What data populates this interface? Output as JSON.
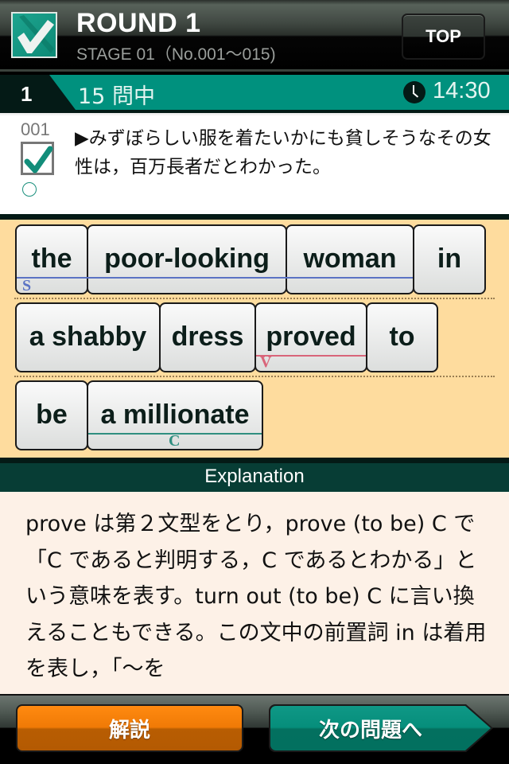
{
  "header": {
    "title": "ROUND 1",
    "subtitle": "STAGE 01（No.001～015)",
    "top_button": "TOP",
    "logo_icon": "checkmark-pencil-icon"
  },
  "question_bar": {
    "number": "1",
    "count_label": "15 問中",
    "timer_icon": "clock-icon",
    "timer": "14:30"
  },
  "question": {
    "id": "001",
    "checked": true,
    "status_icon": "circle-icon",
    "text": "▶みずぼらしい服を着たいかにも貧しそうなその女性は，百万長者だとわかった。"
  },
  "tiles": {
    "rows": [
      [
        {
          "word": "the"
        },
        {
          "word": "poor-looking"
        },
        {
          "word": "woman"
        },
        {
          "word": "in"
        }
      ],
      [
        {
          "word": "a shabby"
        },
        {
          "word": "dress"
        },
        {
          "word": "proved"
        },
        {
          "word": "to"
        }
      ],
      [
        {
          "word": "be"
        },
        {
          "word": "a millionate"
        }
      ]
    ],
    "roles": {
      "subject": {
        "label": "S",
        "color": "#5b73c4"
      },
      "verb": {
        "label": "V",
        "color": "#d9657a"
      },
      "complement": {
        "label": "C",
        "color": "#2f8f80"
      }
    }
  },
  "explanation": {
    "title": "Explanation",
    "text": "prove は第２文型をとり，prove (to be) C で「C であると判明する，C であるとわかる」という意味を表す。turn out (to be) C に言い換えることもできる。この文中の前置詞 in は着用を表し，「～を"
  },
  "footer": {
    "explain_button": "解説",
    "next_button": "次の問題へ"
  },
  "colors": {
    "accent_teal": "#00917e",
    "dark_green": "#041a16",
    "tile_area": "#fedc9e",
    "explanation_bg": "#fdf1e7",
    "orange_button": "#f07a06"
  }
}
